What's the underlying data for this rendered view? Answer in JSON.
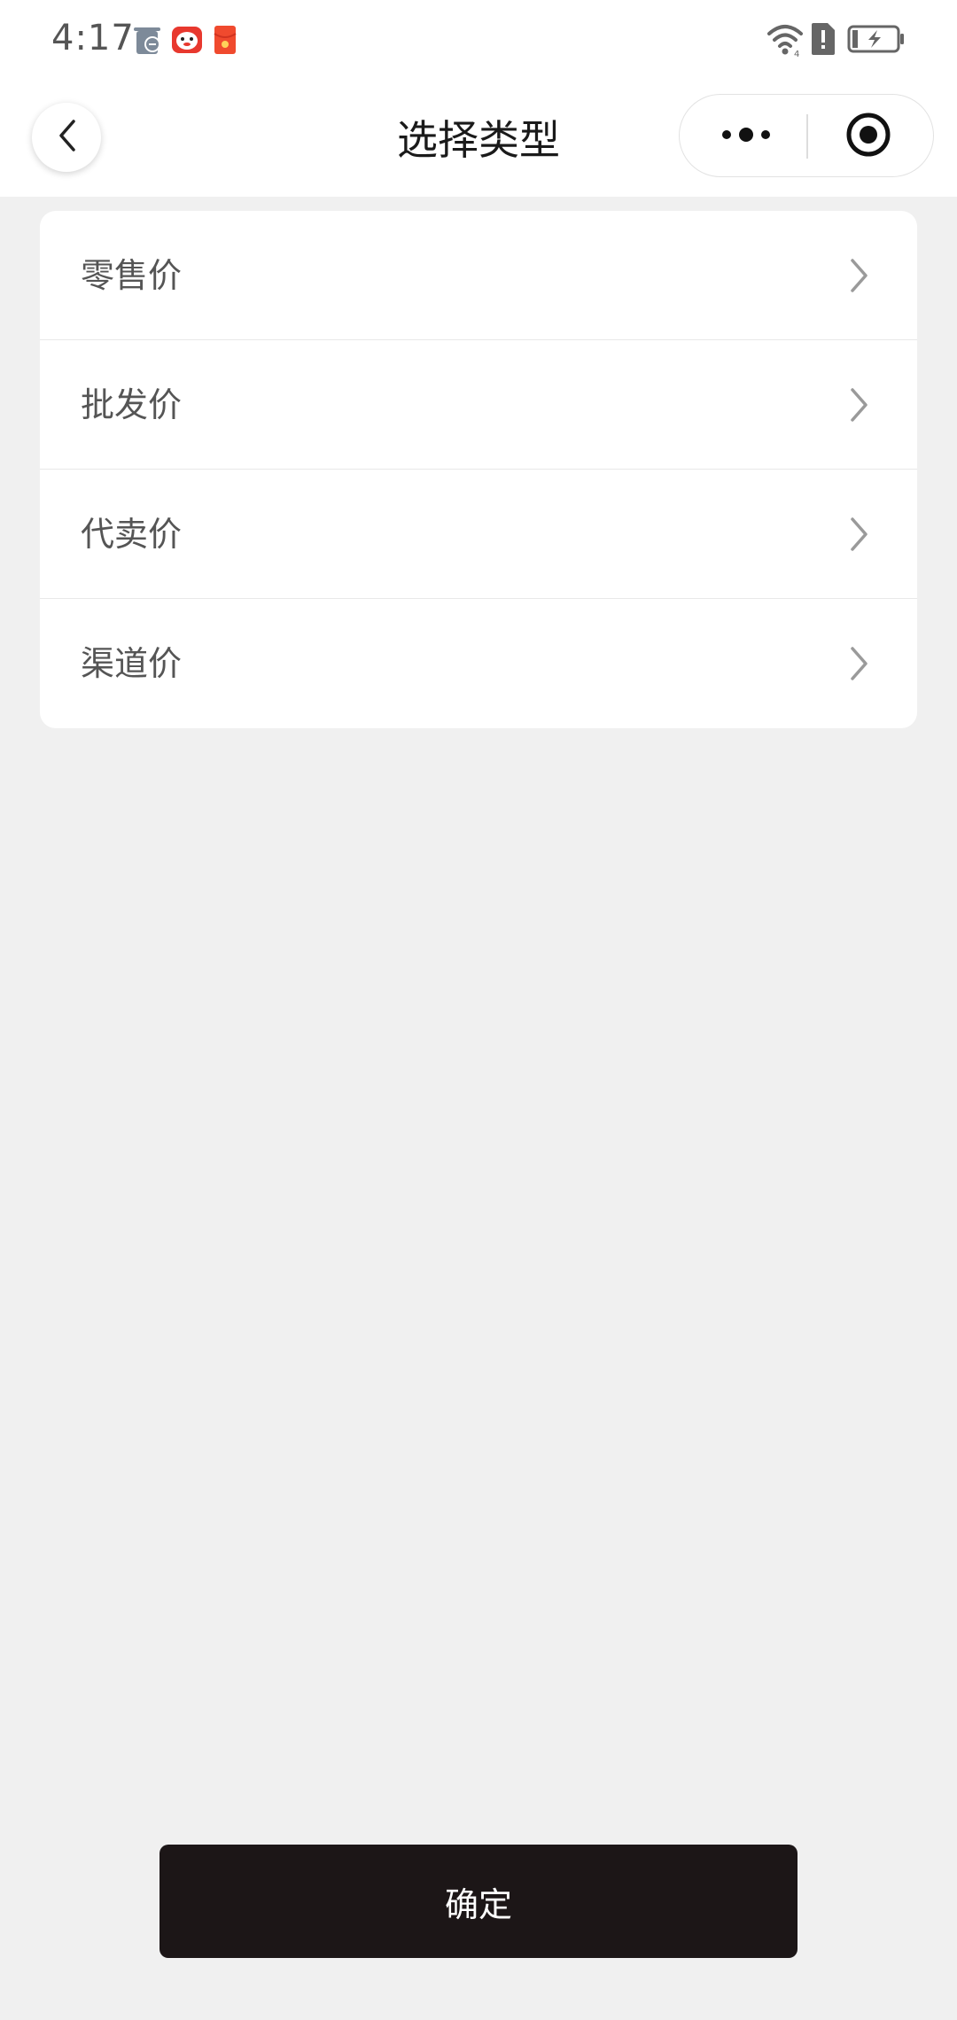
{
  "status_bar": {
    "time": "4:17",
    "notification_icons": [
      "recycle-bin-icon",
      "red-mascot-icon",
      "red-packet-icon"
    ],
    "system_icons": [
      "wifi-icon",
      "alert-icon",
      "battery-charging-icon"
    ]
  },
  "nav": {
    "title": "选择类型",
    "back_icon": "chevron-left-icon",
    "more_icon": "more-dots-icon",
    "close_icon": "target-close-icon"
  },
  "options": [
    {
      "label": "零售价"
    },
    {
      "label": "批发价"
    },
    {
      "label": "代卖价"
    },
    {
      "label": "渠道价"
    }
  ],
  "confirm_label": "确定",
  "colors": {
    "background": "#f0f0f0",
    "card": "#ffffff",
    "confirm_bg": "#1c1617",
    "text_primary": "#1a1a1a",
    "text_secondary": "#555555",
    "chevron": "#9a9a9a",
    "accent_red": "#e8382e"
  }
}
